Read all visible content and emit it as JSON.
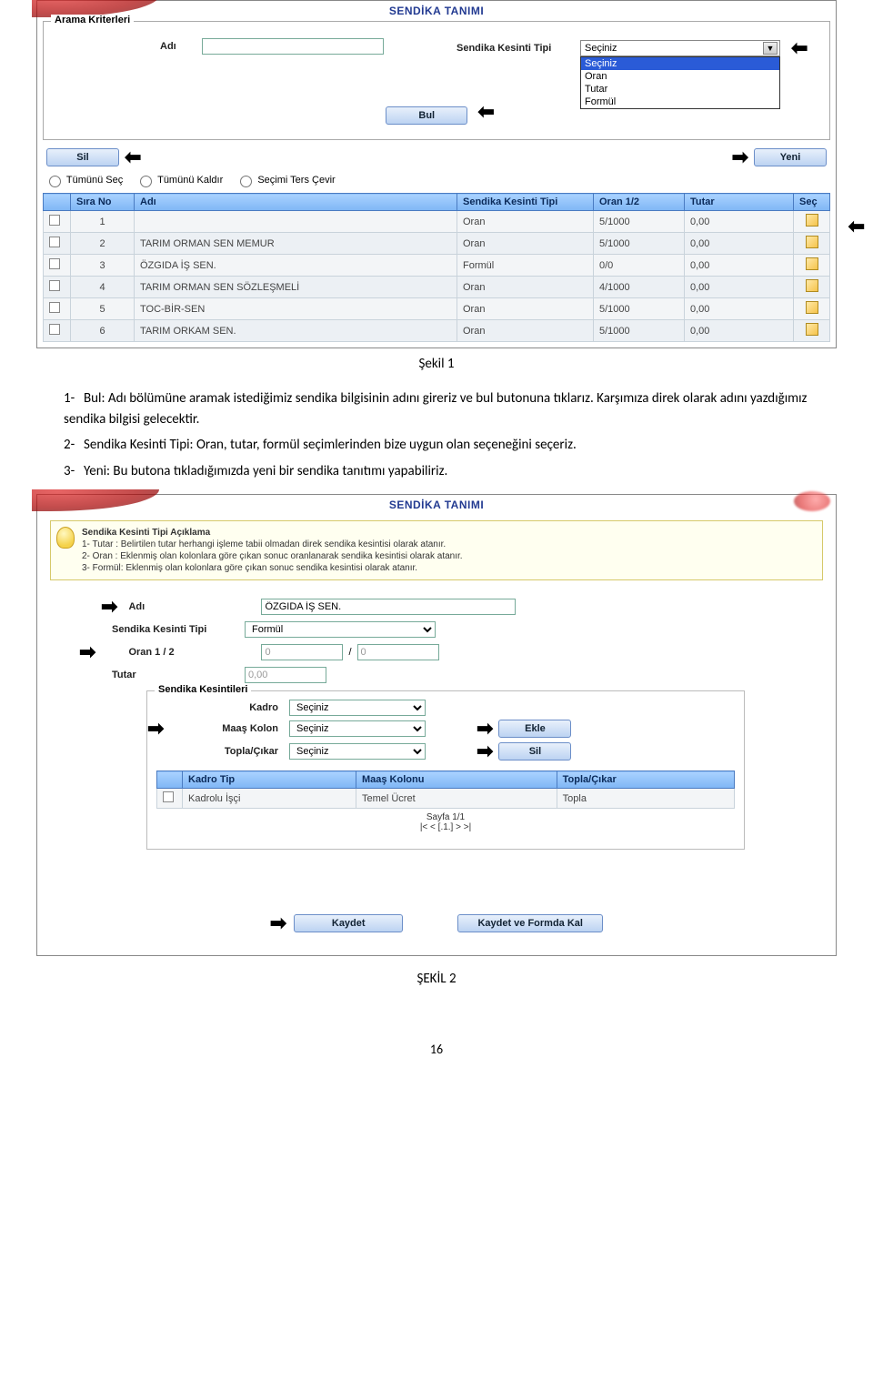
{
  "screenshot1": {
    "title": "SENDİKA TANIMI",
    "search_legend": "Arama Kriterleri",
    "adi_label": "Adı",
    "adi_value": "",
    "tip_label": "Sendika Kesinti Tipi",
    "dd_selected": "Seçiniz",
    "dd_options": [
      "Seçiniz",
      "Oran",
      "Tutar",
      "Formül"
    ],
    "bul": "Bul",
    "sil": "Sil",
    "yeni": "Yeni",
    "radio1": "Tümünü Seç",
    "radio2": "Tümünü Kaldır",
    "radio3": "Seçimi Ters Çevir",
    "headers": [
      "",
      "Sıra No",
      "Adı",
      "Sendika Kesinti Tipi",
      "Oran 1/2",
      "Tutar",
      "Seç"
    ],
    "rows": [
      {
        "no": "1",
        "adi": "",
        "tip": "Oran",
        "oran": "5/1000",
        "tutar": "0,00"
      },
      {
        "no": "2",
        "adi": "TARIM ORMAN SEN MEMUR",
        "tip": "Oran",
        "oran": "5/1000",
        "tutar": "0,00"
      },
      {
        "no": "3",
        "adi": "ÖZGIDA İŞ SEN.",
        "tip": "Formül",
        "oran": "0/0",
        "tutar": "0,00"
      },
      {
        "no": "4",
        "adi": "TARIM ORMAN SEN SÖZLEŞMELİ",
        "tip": "Oran",
        "oran": "4/1000",
        "tutar": "0,00"
      },
      {
        "no": "5",
        "adi": "TOC-BİR-SEN",
        "tip": "Oran",
        "oran": "5/1000",
        "tutar": "0,00"
      },
      {
        "no": "6",
        "adi": "TARIM ORKAM SEN.",
        "tip": "Oran",
        "oran": "5/1000",
        "tutar": "0,00"
      }
    ]
  },
  "caption1": "Şekil 1",
  "text": {
    "p1": "Bul: Adı bölümüne aramak istediğimiz sendika bilgisinin adını gireriz ve bul butonuna tıklarız. Karşımıza direk olarak adını yazdığımız sendika  bilgisi gelecektir.",
    "p2": "Sendika Kesinti Tipi: Oran, tutar, formül seçimlerinden bize uygun olan seçeneğini seçeriz.",
    "p3": "Yeni:  Bu butona tıkladığımızda yeni bir sendika tanıtımı yapabiliriz."
  },
  "screenshot2": {
    "title": "SENDİKA TANIMI",
    "info_title": "Sendika Kesinti Tipi Açıklama",
    "info1": "1- Tutar : Belirtilen tutar herhangi işleme tabii olmadan direk sendika kesintisi olarak atanır.",
    "info2": "2- Oran : Eklenmiş olan kolonlara göre çıkan sonuc oranlanarak sendika kesintisi olarak atanır.",
    "info3": "3- Formül: Eklenmiş olan kolonlara göre çıkan sonuc sendika kesintisi olarak atanır.",
    "adi_label": "Adı",
    "adi_value": "ÖZGIDA İŞ SEN.",
    "tip_label": "Sendika Kesinti Tipi",
    "tip_value": "Formül",
    "oran_label": "Oran 1 / 2",
    "oran_a": "0",
    "oran_sep": "/",
    "oran_b": "0",
    "tutar_label": "Tutar",
    "tutar_value": "0,00",
    "sub_legend": "Sendika Kesintileri",
    "kadro_label": "Kadro",
    "kadro_value": "Seçiniz",
    "maas_label": "Maaş Kolon",
    "maas_value": "Seçiniz",
    "topla_label": "Topla/Çıkar",
    "topla_value": "Seçiniz",
    "ekle": "Ekle",
    "sil": "Sil",
    "tbl_headers": [
      "",
      "Kadro Tip",
      "Maaş Kolonu",
      "Topla/Çıkar"
    ],
    "tbl_row": {
      "kadro": "Kadrolu İşçi",
      "maas": "Temel Ücret",
      "topla": "Topla"
    },
    "pager_line1": "Sayfa 1/1",
    "pager_line2": "|<  <  [.1.]  >  >|",
    "kaydet": "Kaydet",
    "kaydet_kal": "Kaydet ve Formda Kal"
  },
  "caption2": "ŞEKİL 2",
  "page_num": "16"
}
